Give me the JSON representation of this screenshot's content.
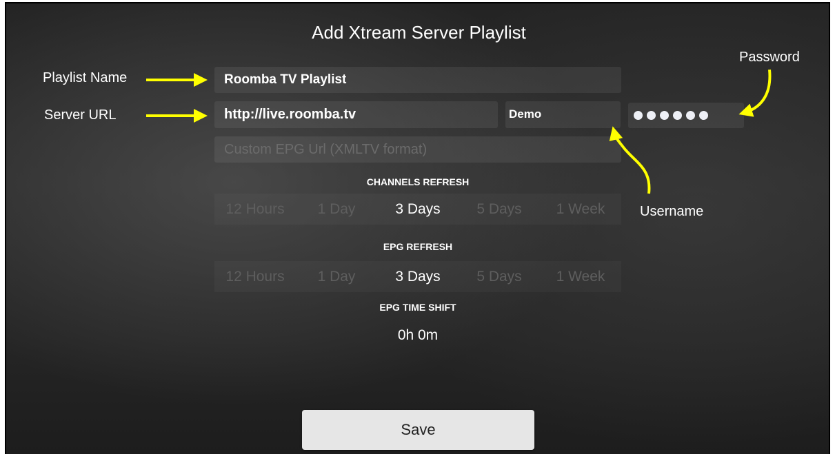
{
  "title": "Add Xtream Server Playlist",
  "fields": {
    "playlist_name": "Roomba TV Playlist",
    "server_url": "http://live.roomba.tv",
    "username": "Demo",
    "password_mask": "••••••",
    "epg_url_placeholder": "Custom EPG Url (XMLTV format)"
  },
  "channels_refresh": {
    "label": "CHANNELS REFRESH",
    "options": [
      "12 Hours",
      "1 Day",
      "3 Days",
      "5 Days",
      "1 Week"
    ],
    "selected": "3 Days"
  },
  "epg_refresh": {
    "label": "EPG REFRESH",
    "options": [
      "12 Hours",
      "1 Day",
      "3 Days",
      "5 Days",
      "1 Week"
    ],
    "selected": "3 Days"
  },
  "epg_time_shift": {
    "label": "EPG TIME SHIFT",
    "value": "0h 0m"
  },
  "save_label": "Save",
  "annotations": {
    "playlist_name": "Playlist Name",
    "server_url": "Server URL",
    "password": "Password",
    "username": "Username"
  },
  "colors": {
    "background": "#262626",
    "arrow": "#ffff00",
    "field_text": "#ffffff",
    "placeholder": "#6b6b6b",
    "unselected_option": "#5e5e5e",
    "save_button": "#e6e6e6"
  }
}
